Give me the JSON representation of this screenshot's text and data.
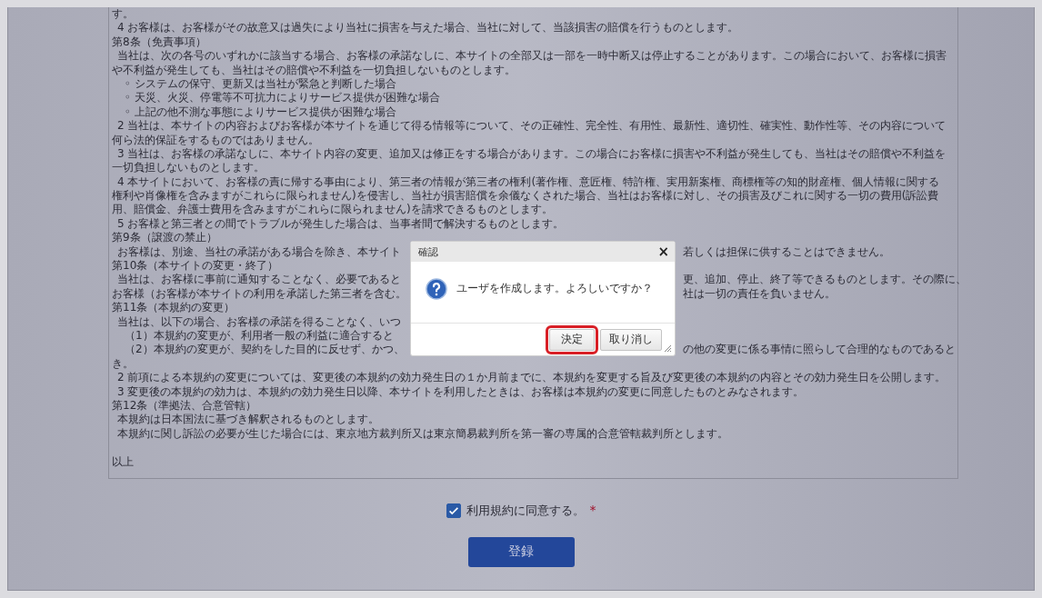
{
  "terms": {
    "lines": [
      {
        "kind": "plain",
        "text": "す。"
      },
      {
        "kind": "para",
        "text": "4 お客様は、お客様がその故意又は過失により当社に損害を与えた場合、当社に対して、当該損害の賠償を行うものとします。"
      },
      {
        "kind": "plain",
        "text": "第8条（免責事項）"
      },
      {
        "kind": "para",
        "text": "当社は、次の各号のいずれかに該当する場合、お客様の承諾なしに、本サイトの全部又は一部を一時中断又は停止することがあります。この場合において、お客様に損害"
      },
      {
        "kind": "plain",
        "text": "や不利益が発生しても、当社はその賠償や不利益を一切負担しないものとします。"
      },
      {
        "kind": "sub",
        "text": "◦ システムの保守、更新又は当社が緊急と判断した場合"
      },
      {
        "kind": "sub",
        "text": "◦ 天災、火災、停電等不可抗力によりサービス提供が困難な場合"
      },
      {
        "kind": "sub",
        "text": "◦ 上記の他不測な事態によりサービス提供が困難な場合"
      },
      {
        "kind": "para",
        "text": "2 当社は、本サイトの内容およびお客様が本サイトを通じて得る情報等について、その正確性、完全性、有用性、最新性、適切性、確実性、動作性等、その内容について"
      },
      {
        "kind": "plain",
        "text": "何ら法的保証をするものではありません。"
      },
      {
        "kind": "para",
        "text": "3 当社は、お客様の承諾なしに、本サイト内容の変更、追加又は修正をする場合があります。この場合にお客様に損害や不利益が発生しても、当社はその賠償や不利益を"
      },
      {
        "kind": "plain",
        "text": "一切負担しないものとします。"
      },
      {
        "kind": "para",
        "text": "4 本サイトにおいて、お客様の責に帰する事由により、第三者の情報が第三者の権利(著作権、意匠権、特許権、実用新案権、商標権等の知的財産権、個人情報に関する"
      },
      {
        "kind": "plain",
        "text": "権利や肖像権を含みますがこれらに限られません)を侵害し、当社が損害賠償を余儀なくされた場合、当社はお客様に対し、その損害及びこれに関する一切の費用(訴訟費"
      },
      {
        "kind": "plain",
        "text": "用、賠償金、弁護士費用を含みますがこれらに限られません)を請求できるものとします。"
      },
      {
        "kind": "para",
        "text": "5 お客様と第三者との間でトラブルが発生した場合は、当事者間で解決するものとします。"
      },
      {
        "kind": "plain",
        "text": "第9条（譲渡の禁止）"
      },
      {
        "kind": "para",
        "text": "お客様は、別途、当社の承諾がある場合を除き、本サイト",
        "text_right": "若しくは担保に供することはできません。"
      },
      {
        "kind": "plain",
        "text": "第10条（本サイトの変更・終了）"
      },
      {
        "kind": "para",
        "text": "当社は、お客様に事前に通知することなく、必要であると",
        "text_right": "更、追加、停止、終了等できるものとします。その際に、"
      },
      {
        "kind": "plain",
        "text": "お客様（お客様が本サイトの利用を承諾した第三者を含む。",
        "text_right": "社は一切の責任を負いません。"
      },
      {
        "kind": "plain",
        "text": "第11条（本規約の変更）"
      },
      {
        "kind": "para",
        "text": "当社は、以下の場合、お客様の承諾を得ることなく、いつ"
      },
      {
        "kind": "sub",
        "text": "（1）本規約の変更が、利用者一般の利益に適合すると"
      },
      {
        "kind": "sub",
        "text": "（2）本規約の変更が、契約をした目的に反せず、かつ、",
        "text_right": "の他の変更に係る事情に照らして合理的なものであると"
      },
      {
        "kind": "plain",
        "text": "き。"
      },
      {
        "kind": "para",
        "text": "2 前項による本規約の変更については、変更後の本規約の効力発生日の１か月前までに、本規約を変更する旨及び変更後の本規約の内容とその効力発生日を公開します。"
      },
      {
        "kind": "para",
        "text": "3 変更後の本規約の効力は、本規約の効力発生日以降、本サイトを利用したときは、お客様は本規約の変更に同意したものとみなされます。"
      },
      {
        "kind": "plain",
        "text": "第12条（準拠法、合意管轄）"
      },
      {
        "kind": "para",
        "text": "本規約は日本国法に基づき解釈されるものとします。"
      },
      {
        "kind": "para",
        "text": "本規約に関し訴訟の必要が生じた場合には、東京地方裁判所又は東京簡易裁判所を第一審の専属的合意管轄裁判所とします。"
      },
      {
        "kind": "blank"
      },
      {
        "kind": "plain",
        "text": "以上"
      }
    ]
  },
  "agreement": {
    "label": "利用規約に同意する。",
    "checked": true,
    "required_mark": "*"
  },
  "register_button": "登録",
  "dialog": {
    "title": "確認",
    "close": "×",
    "message": "ユーザを作成します。よろしいですか？",
    "buttons": [
      {
        "label": "決定",
        "highlighted": true
      },
      {
        "label": "取り消し",
        "highlighted": false
      }
    ]
  }
}
